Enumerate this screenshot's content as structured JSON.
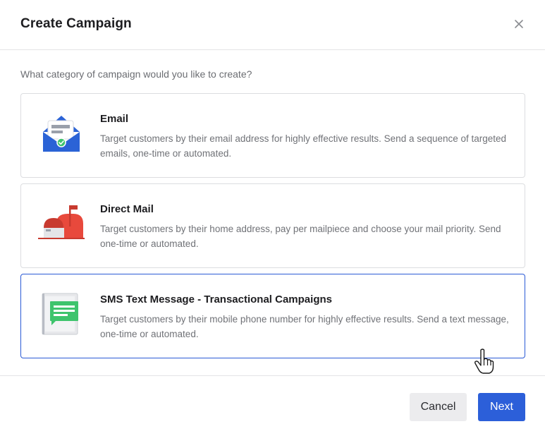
{
  "dialog": {
    "title": "Create Campaign",
    "close_icon": "close-icon"
  },
  "prompt": "What category of campaign would you like to create?",
  "options": [
    {
      "icon": "email-envelope-icon",
      "title": "Email",
      "description": "Target customers by their email address for highly effective results. Send a sequence of targeted emails, one-time or automated.",
      "selected": false
    },
    {
      "icon": "mailbox-icon",
      "title": "Direct Mail",
      "description": "Target customers by their home address, pay per mailpiece and choose your mail priority. Send one-time or automated.",
      "selected": false
    },
    {
      "icon": "sms-message-icon",
      "title": "SMS Text Message - Transactional Campaigns",
      "description": "Target customers by their mobile phone number for highly effective results. Send a text message, one-time or automated.",
      "selected": true
    }
  ],
  "footer": {
    "cancel_label": "Cancel",
    "next_label": "Next"
  },
  "colors": {
    "primary": "#2c5fd9",
    "selected_border": "#2a5ad6",
    "email_blue": "#2b63d6",
    "mail_red": "#e8493c",
    "sms_green": "#3ec46d"
  }
}
